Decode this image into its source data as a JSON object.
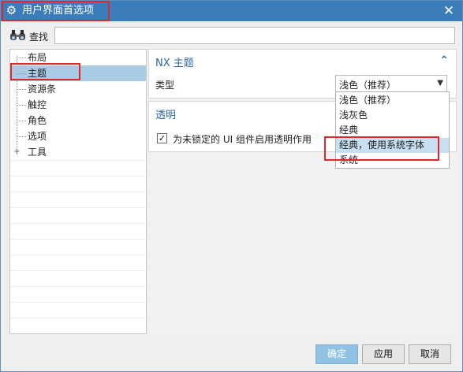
{
  "window": {
    "title": "用户界面首选项",
    "close_symbol": "✕"
  },
  "find": {
    "label": "查找",
    "value": ""
  },
  "tree": {
    "items": [
      {
        "label": "布局"
      },
      {
        "label": "主题"
      },
      {
        "label": "资源条"
      },
      {
        "label": "触控"
      },
      {
        "label": "角色"
      },
      {
        "label": "选项"
      },
      {
        "label": "工具",
        "expander": "+"
      }
    ]
  },
  "theme_section": {
    "title": "NX 主题",
    "type_label": "类型",
    "type_value": "浅色（推荐）"
  },
  "transparency_section": {
    "title": "透明",
    "checkbox_label": "为未锁定的 UI 组件启用透明作用",
    "checkbox_checked": true
  },
  "dropdown_options": [
    "浅色（推荐）",
    "浅灰色",
    "经典",
    "经典，使用系统字体",
    "系统"
  ],
  "buttons": {
    "ok": "确定",
    "apply": "应用",
    "cancel": "取消"
  }
}
